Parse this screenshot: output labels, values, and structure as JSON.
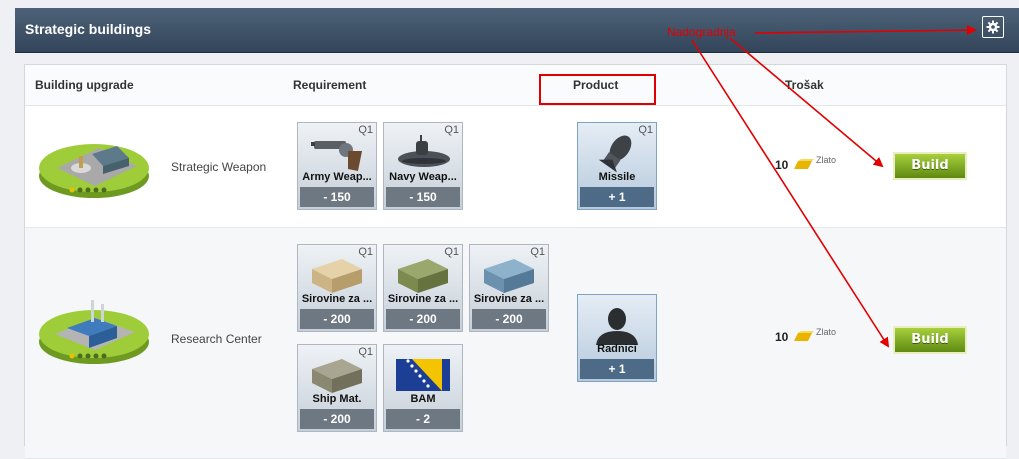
{
  "header": {
    "title": "Strategic buildings",
    "settings_icon": "gear-icon"
  },
  "table": {
    "columns": {
      "building": "Building upgrade",
      "requirement": "Requirement",
      "product": "Product",
      "cost": "Trošak"
    },
    "rows": [
      {
        "name": "Strategic Weapon",
        "requirements": [
          {
            "name": "Army Weap...",
            "quality": "Q1",
            "value": "- 150",
            "icon": "revolver-icon"
          },
          {
            "name": "Navy Weap...",
            "quality": "Q1",
            "value": "- 150",
            "icon": "submarine-icon"
          }
        ],
        "product": {
          "name": "Missile",
          "quality": "Q1",
          "value": "+ 1",
          "icon": "missile-icon"
        },
        "cost": {
          "amount": "10",
          "currency": "Zlato"
        },
        "build_label": "Build"
      },
      {
        "name": "Research Center",
        "requirements": [
          {
            "name": "Sirovine za ...",
            "quality": "Q1",
            "value": "- 200",
            "icon": "crate-icon"
          },
          {
            "name": "Sirovine za ...",
            "quality": "Q1",
            "value": "- 200",
            "icon": "crate-icon"
          },
          {
            "name": "Sirovine za ...",
            "quality": "Q1",
            "value": "- 200",
            "icon": "crate-icon"
          },
          {
            "name": "Ship Mat.",
            "quality": "Q1",
            "value": "- 200",
            "icon": "crate-icon"
          },
          {
            "name": "BAM",
            "quality": "",
            "value": "- 2",
            "icon": "bosnia-flag-icon"
          }
        ],
        "product": {
          "name": "Radnici",
          "quality": "",
          "value": "+ 1",
          "icon": "worker-silhouette-icon"
        },
        "cost": {
          "amount": "10",
          "currency": "Zlato"
        },
        "build_label": "Build"
      }
    ]
  },
  "annotation": {
    "label": "Nadogradnja",
    "color": "#e10000"
  },
  "colors": {
    "header": "#3f5469",
    "build_button": "#7fb01f",
    "annotation": "#e10000"
  }
}
